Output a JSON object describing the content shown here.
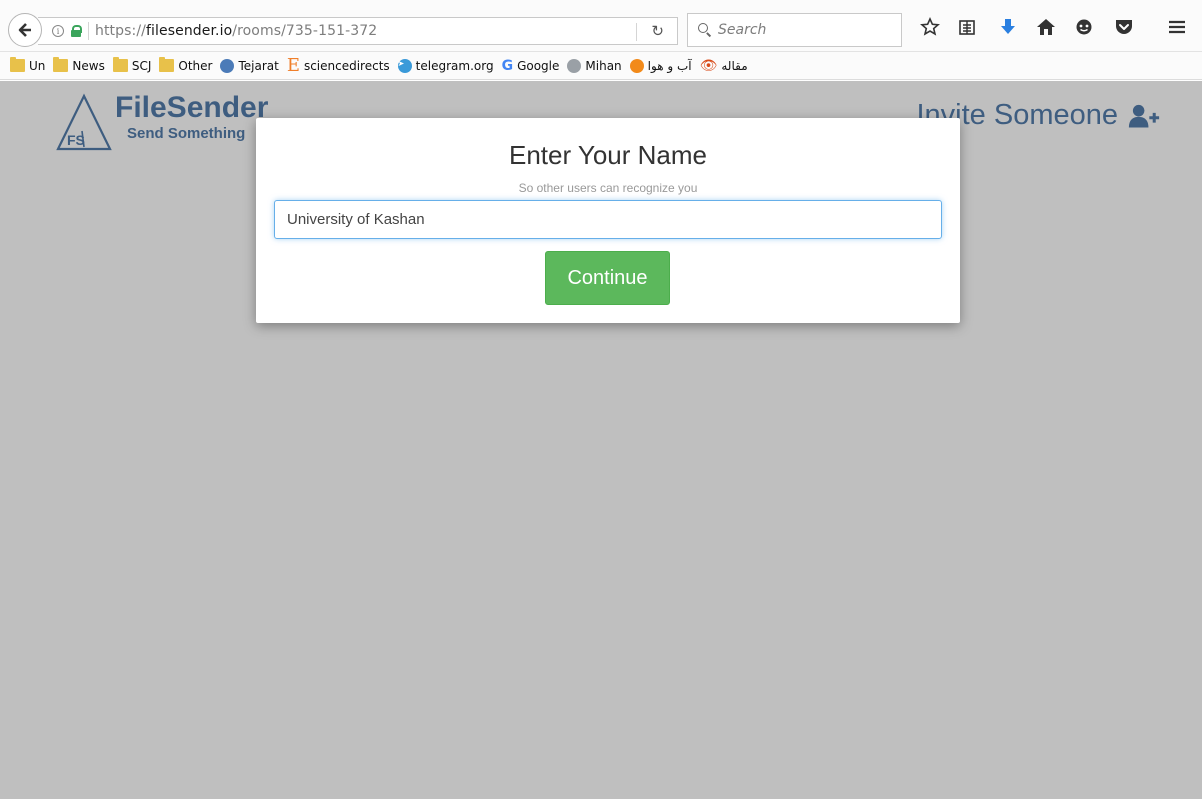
{
  "browser": {
    "url_prefix": "https://",
    "url_host": "filesender.io",
    "url_path": "/rooms/735-151-372",
    "search_placeholder": "Search",
    "icons": [
      "back-arrow-icon",
      "info-icon",
      "lock-icon",
      "reload-icon",
      "search-icon",
      "star-icon",
      "reading-list-icon",
      "download-icon",
      "home-icon",
      "chat-icon",
      "pocket-icon",
      "menu-icon"
    ]
  },
  "bookmarks": [
    {
      "label": "Un",
      "icon": "folder-icon"
    },
    {
      "label": "News",
      "icon": "folder-icon"
    },
    {
      "label": "SCJ",
      "icon": "folder-icon"
    },
    {
      "label": "Other",
      "icon": "folder-icon"
    },
    {
      "label": "Tejarat",
      "icon": "tejarat-icon"
    },
    {
      "label": "sciencedirects",
      "icon": "elsevier-icon"
    },
    {
      "label": "telegram.org",
      "icon": "telegram-icon"
    },
    {
      "label": "Google",
      "icon": "google-icon"
    },
    {
      "label": "Mihan",
      "icon": "mihan-icon"
    },
    {
      "label": "آب و هوا",
      "icon": "weather-icon"
    },
    {
      "label": "مقاله",
      "icon": "eye-icon"
    }
  ],
  "header": {
    "brand_name": "FileSender",
    "brand_tagline": "Send Something",
    "logo_letters": "FS",
    "invite_label": "Invite Someone"
  },
  "modal": {
    "title": "Enter Your Name",
    "subtitle": "So other users can recognize you",
    "name_value": "University of Kashan",
    "continue_label": "Continue"
  },
  "colors": {
    "brand": "#3e5d80",
    "continue_button": "#5cb85c",
    "page_overlay": "#bfbfbf"
  }
}
